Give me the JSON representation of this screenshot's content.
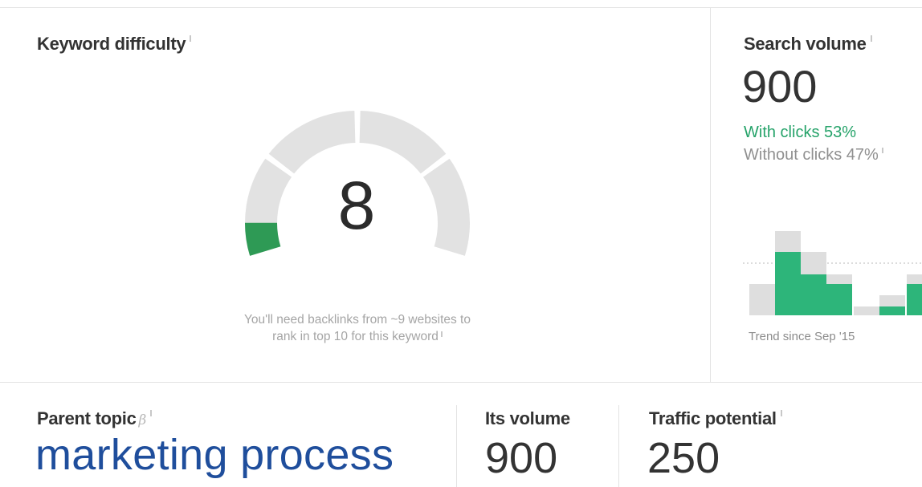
{
  "keyword_difficulty": {
    "title": "Keyword difficulty",
    "value": "8",
    "score": 8,
    "max": 100,
    "note_line1": "You'll need backlinks from ~9 websites to",
    "note_line2": "rank in top 10 for this keyword",
    "colors": {
      "track": "#e2e2e2",
      "fill": "#2e9a55"
    }
  },
  "search_volume": {
    "title": "Search volume",
    "value": "900",
    "with_clicks": "With clicks 53%",
    "without_clicks": "Without clicks 47%",
    "trend_label": "Trend since Sep '15",
    "colors": {
      "with_clicks": "#26a36a",
      "without_clicks": "#909090"
    }
  },
  "parent_topic": {
    "title": "Parent topic",
    "beta_mark": "β",
    "value": "marketing process"
  },
  "its_volume": {
    "title": "Its volume",
    "value": "900"
  },
  "traffic_potential": {
    "title": "Traffic potential",
    "value": "250"
  },
  "icons": {
    "info": "info-icon"
  },
  "colors": {
    "link": "#1f4e9c",
    "green": "#2db57a",
    "grey_bar": "#dedede",
    "rule": "#e3e3e3"
  }
}
